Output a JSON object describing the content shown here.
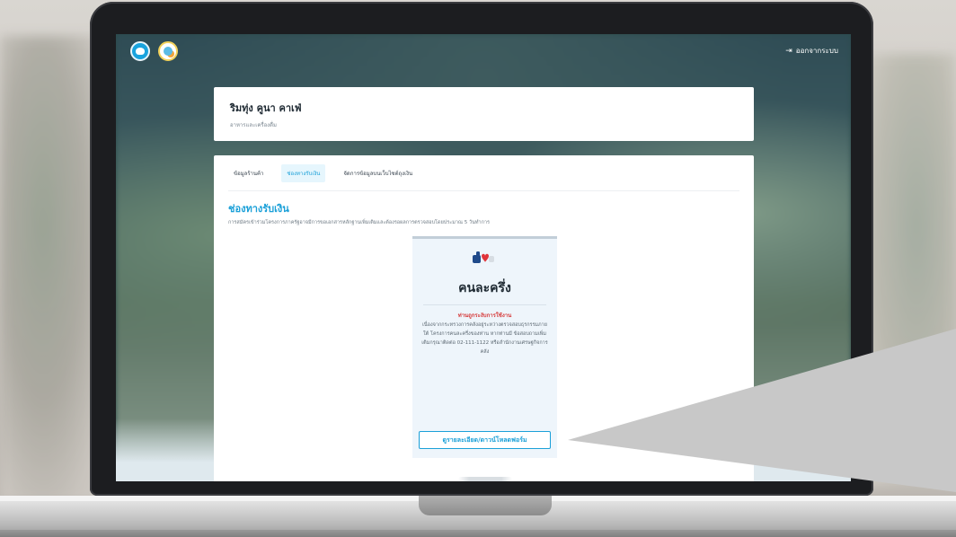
{
  "topbar": {
    "logout_label": "ออกจากระบบ",
    "logout_icon": "logout-icon"
  },
  "shop": {
    "name": "ริมทุ่ง คูนา คาเฟ่",
    "category": "อาหารและเครื่องดื่ม"
  },
  "tabs": [
    {
      "label": "ข้อมูลร้านค้า",
      "active": false
    },
    {
      "label": "ช่องทางรับเงิน",
      "active": true
    },
    {
      "label": "จัดการข้อมูลบนเว็บไซต์ถุงเงิน",
      "active": false
    }
  ],
  "section": {
    "title": "ช่องทางรับเงิน",
    "description": "การสมัครเข้าร่วมโครงการภาครัฐอาจมีการขอเอกสารหลักฐานเพิ่มเติมและต้องรอผลการตรวจสอบโดยประมาณ 5 วันทำการ"
  },
  "program": {
    "logo_icon": "khon-la-khrueng-logo-icon",
    "title": "คนละครึ่ง",
    "notice_title": "ท่านถูกระงับการใช้งาน",
    "notice_text": "เนื่องจากกระทรวงการคลังอยู่ระหว่างตรวจสอบธุรกรรมภายใต้ โครงการคนละครึ่งของท่าน หากท่านมี ข้อสอบถามเพิ่มเติมกรุณาติดต่อ 02-111-1122 หรือสำนักงานเศรษฐกิจการคลัง",
    "detail_button_label": "ดูรายละเอียด/ดาวน์โหลดฟอร์ม"
  },
  "colors": {
    "accent": "#1ba0d8",
    "alert": "#d63a3a",
    "card_bg": "#ffffff",
    "panel_bg": "#eef5fb"
  }
}
